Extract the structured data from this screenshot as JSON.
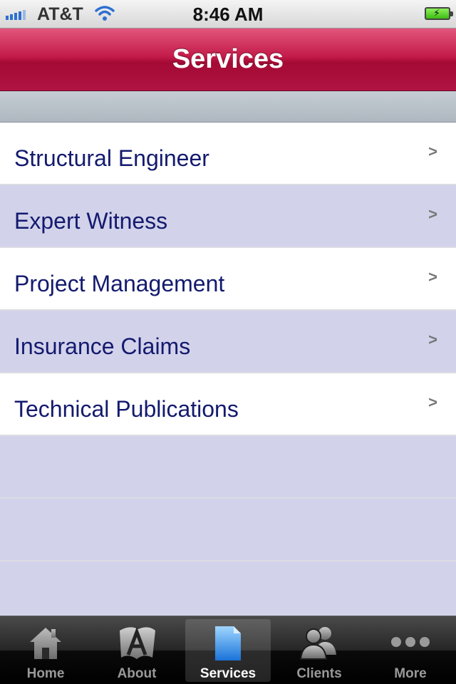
{
  "status_bar": {
    "carrier": "AT&T",
    "time": "8:46 AM",
    "signal_icon": "signal-bars-icon",
    "wifi_icon": "wifi-icon",
    "battery_icon": "battery-charging-icon"
  },
  "nav_bar": {
    "title": "Services",
    "color": "#b01343"
  },
  "services": {
    "items": [
      {
        "label": "Structural Engineer"
      },
      {
        "label": "Expert Witness"
      },
      {
        "label": "Project Management"
      },
      {
        "label": "Insurance Claims"
      },
      {
        "label": "Technical Publications"
      }
    ],
    "chevron": ">"
  },
  "tab_bar": {
    "tabs": [
      {
        "label": "Home",
        "icon": "home-icon"
      },
      {
        "label": "About",
        "icon": "about-icon"
      },
      {
        "label": "Services",
        "icon": "document-icon",
        "selected": true
      },
      {
        "label": "Clients",
        "icon": "people-icon"
      },
      {
        "label": "More",
        "icon": "more-icon"
      }
    ]
  }
}
